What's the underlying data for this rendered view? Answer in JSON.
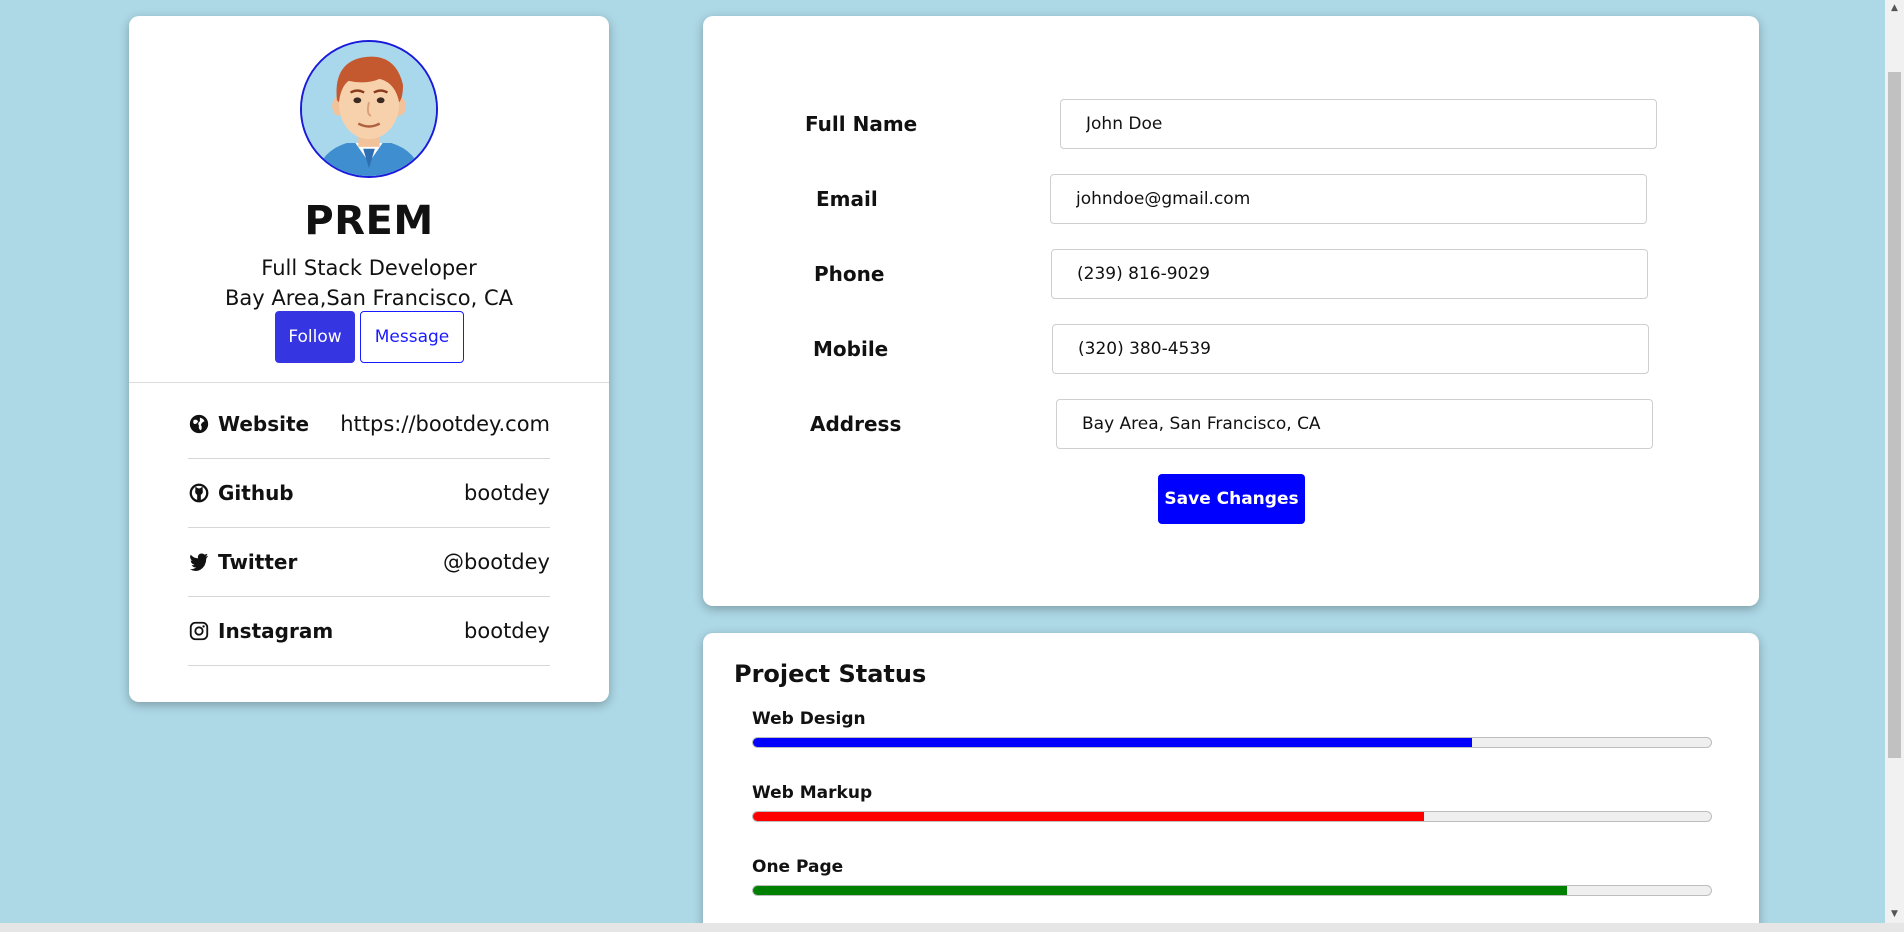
{
  "profile": {
    "name": "PREM",
    "role": "Full Stack Developer",
    "location": "Bay Area,San Francisco, CA",
    "follow_label": "Follow",
    "message_label": "Message",
    "avatar_icon": "cartoon-man-avatar",
    "links": [
      {
        "icon": "globe-icon",
        "label": "Website",
        "value": "https://bootdey.com"
      },
      {
        "icon": "github-icon",
        "label": "Github",
        "value": "bootdey"
      },
      {
        "icon": "twitter-icon",
        "label": "Twitter",
        "value": "@bootdey"
      },
      {
        "icon": "instagram-icon",
        "label": "Instagram",
        "value": "bootdey"
      }
    ]
  },
  "form": {
    "fields": [
      {
        "label": "Full Name",
        "value": "John Doe"
      },
      {
        "label": "Email",
        "value": "johndoe@gmail.com"
      },
      {
        "label": "Phone",
        "value": "(239) 816-9029"
      },
      {
        "label": "Mobile",
        "value": "(320) 380-4539"
      },
      {
        "label": "Address",
        "value": "Bay Area, San Francisco, CA"
      }
    ],
    "save_label": "Save Changes"
  },
  "project_status": {
    "title": "Project Status",
    "items": [
      {
        "label": "Web Design",
        "percent": 75,
        "color": "#0000ff"
      },
      {
        "label": "Web Markup",
        "percent": 70,
        "color": "#ff0000"
      },
      {
        "label": "One Page",
        "percent": 85,
        "color": "#008000"
      }
    ]
  },
  "colors": {
    "background": "#add8e6",
    "follow_button": "#3535e2",
    "save_button": "#0000ff",
    "avatar_border": "#1a1adb"
  }
}
